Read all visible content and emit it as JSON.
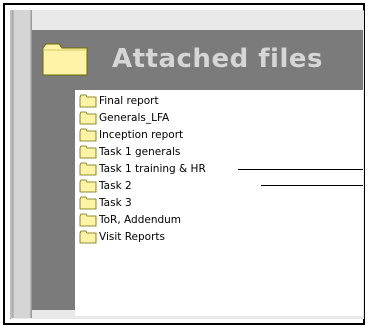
{
  "header": {
    "title": "Attached files",
    "icon": "folder-icon"
  },
  "files": [
    {
      "label": "Final report",
      "icon": "folder-icon"
    },
    {
      "label": "Generals_LFA",
      "icon": "folder-icon"
    },
    {
      "label": "Inception report",
      "icon": "folder-icon"
    },
    {
      "label": "Task 1 generals",
      "icon": "folder-icon"
    },
    {
      "label": "Task 1 training & HR",
      "icon": "folder-icon"
    },
    {
      "label": "Task 2",
      "icon": "folder-icon"
    },
    {
      "label": "Task 3",
      "icon": "folder-icon"
    },
    {
      "label": "ToR, Addendum",
      "icon": "folder-icon"
    },
    {
      "label": "Visit Reports",
      "icon": "folder-icon"
    }
  ],
  "colors": {
    "folder_fill": "#fff3a8",
    "header_bg": "#7b7b7b",
    "title_text": "#d6d6d6"
  }
}
